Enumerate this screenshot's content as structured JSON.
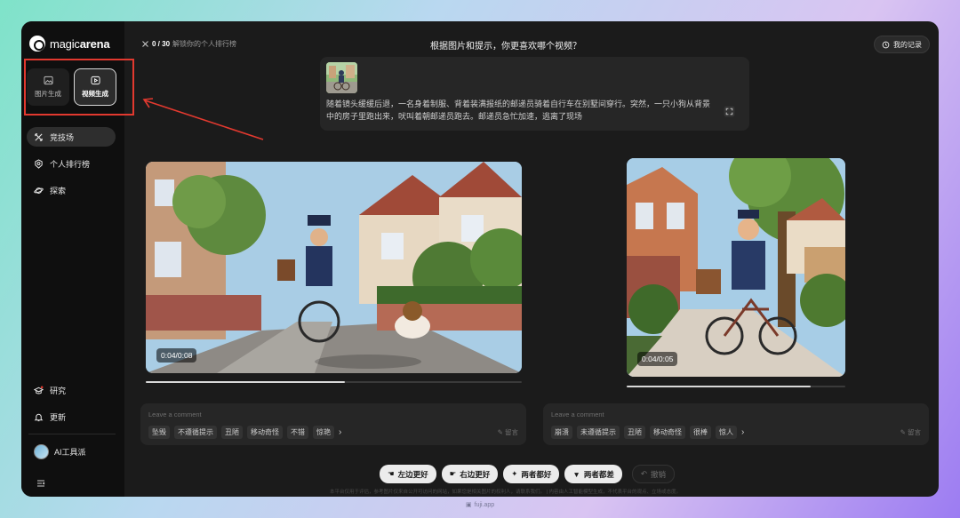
{
  "brand": {
    "prefix": "magic",
    "suffix": "arena"
  },
  "gen_tabs": [
    {
      "label": "图片生成",
      "icon": "image-icon",
      "active": false
    },
    {
      "label": "视频生成",
      "icon": "video-icon",
      "active": true
    }
  ],
  "nav": [
    {
      "label": "竞技场",
      "icon": "arena-icon",
      "active": true
    },
    {
      "label": "个人排行榜",
      "icon": "medal-icon",
      "active": false
    },
    {
      "label": "探索",
      "icon": "planet-icon",
      "active": false
    },
    {
      "label": "研究",
      "icon": "research-icon",
      "active": false
    },
    {
      "label": "更新",
      "icon": "bell-icon",
      "active": false
    }
  ],
  "user": {
    "name": "AI工具派"
  },
  "header": {
    "progress": "0 / 30",
    "progress_caption": "解锁你的个人排行榜",
    "question": "根据图片和提示，你更喜欢哪个视频？",
    "history_label": "我的记录"
  },
  "prompt": {
    "text": "随着镜头缓缓后退，一名身着制服、背着装满报纸的邮递员骑着自行车在别墅间穿行。突然，一只小狗从背景中的房子里跑出来，吠叫着朝邮递员跑去。邮递员急忙加速，逃离了现场"
  },
  "videos": [
    {
      "time": "0:04/0:08",
      "progress": 0.53
    },
    {
      "time": "0:04/0:05",
      "progress": 0.84
    }
  ],
  "comments": [
    {
      "placeholder": "Leave a comment",
      "tags": [
        "坠毁",
        "不遵循提示",
        "丑陋",
        "移动奇怪",
        "不错",
        "惊艳"
      ],
      "post_label": "留言"
    },
    {
      "placeholder": "Leave a comment",
      "tags": [
        "崩溃",
        "未遵循提示",
        "丑陋",
        "移动奇怪",
        "很棒",
        "惊人"
      ],
      "post_label": "留言"
    }
  ],
  "votes": {
    "left": "左边更好",
    "right": "右边更好",
    "both_good": "两者都好",
    "both_bad": "两者都差",
    "undo": "撤销"
  },
  "footnote": "本平台仅用于评估，参考图片仅来自公开可访问的网站，如果您是相关图片的权利人，请联系我们。 | 内容由人工智能模型生成，不代表平台的观点、立场或态度。",
  "watermark": "fuji.app",
  "colors": {
    "annotation": "#e2392f",
    "background": "#1b1b1b",
    "sidebar": "#0f0f0f"
  }
}
